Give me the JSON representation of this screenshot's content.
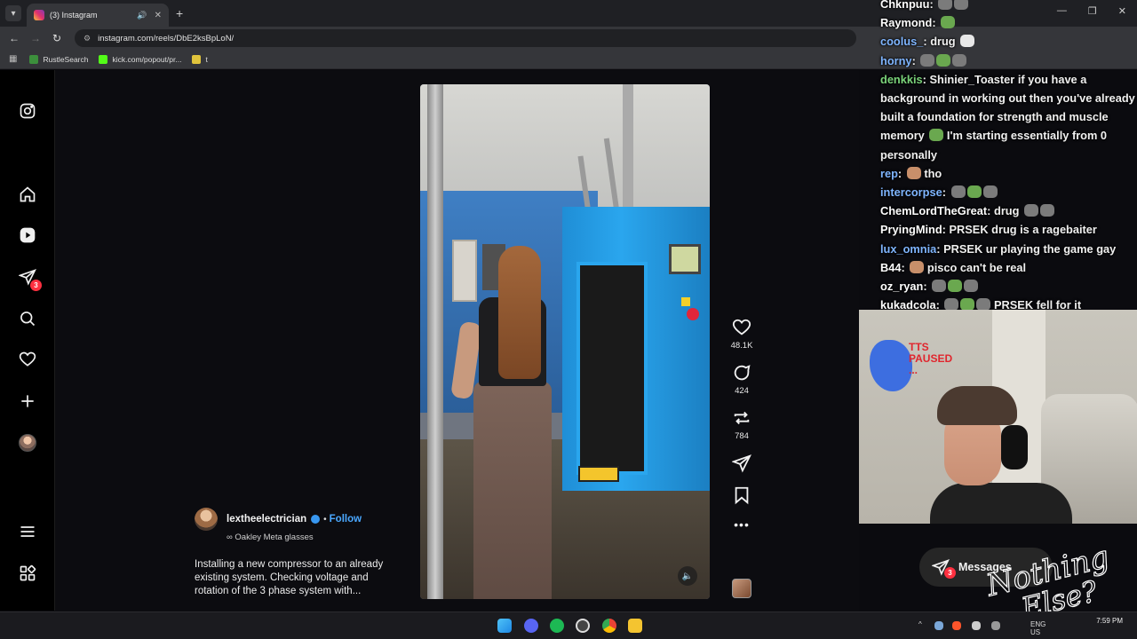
{
  "browser": {
    "tab_title": "(3) Instagram",
    "url": "instagram.com/reels/DbE2ksBpLoN/",
    "bookmarks": [
      {
        "label": "RustleSearch"
      },
      {
        "label": "kick.com/popout/pr..."
      },
      {
        "label": "t"
      }
    ]
  },
  "instagram": {
    "nav_notifications_count": "3",
    "reel": {
      "username": "lextheelectrician",
      "separator": "•",
      "follow_label": "Follow",
      "audio_icon": "∞",
      "audio_label": "Oakley Meta glasses",
      "caption": "Installing a new compressor to an already existing system. Checking voltage and rotation of the 3 phase system with..."
    },
    "actions": {
      "likes": "48.1K",
      "comments": "424",
      "reposts": "784",
      "more": "•••"
    },
    "messages": {
      "label": "Messages",
      "badge": "3"
    }
  },
  "chat": [
    {
      "user": "Chknpuu",
      "msg": "",
      "color": "#ffffff"
    },
    {
      "user": "Raymond",
      "msg": "",
      "color": "#ffffff"
    },
    {
      "user": "coolus_",
      "msg": "drug",
      "color": "#7fb5ff"
    },
    {
      "user": "horny",
      "msg": "",
      "color": "#7fb5ff"
    },
    {
      "user": "denkkis",
      "msg": "Shinier_Toaster if you have a background in working out then you've already built a foundation for strength and muscle memory",
      "tail": "I'm starting essentially from 0 personally",
      "color": "#7ad37a"
    },
    {
      "user": "rep",
      "msg": "tho",
      "color": "#7fb5ff"
    },
    {
      "user": "intercorpse",
      "msg": "",
      "color": "#7fb5ff"
    },
    {
      "user": "ChemLordTheGreat",
      "msg": "drug",
      "color": "#ffffff"
    },
    {
      "user": "PryingMind",
      "msg": "PRSEK drug is a ragebaiter",
      "color": "#ffffff"
    },
    {
      "user": "lux_omnia",
      "msg": "PRSEK ur playing the game gay",
      "color": "#7fb5ff"
    },
    {
      "user": "B44",
      "msg": "pisco can't be real",
      "color": "#ffffff"
    },
    {
      "user": "oz_ryan",
      "msg": "",
      "color": "#ffffff"
    },
    {
      "user": "kukadcola",
      "msg": "PRSEK fell for it",
      "color": "#ffffff"
    }
  ],
  "webcam": {
    "overlay_text_1": "TTS",
    "overlay_text_2": "PAUSED",
    "overlay_text_3": "..."
  },
  "overlay_logo": {
    "line1": "Nothing",
    "line2": "Else?"
  },
  "taskbar": {
    "lang": "ENG",
    "region": "US",
    "time": "7:59 PM"
  },
  "colors": {
    "instagram_bg": "#0c0c10",
    "follow_blue": "#4aa8ff",
    "notification_red": "#ff3040",
    "compressor_blue": "#2aa6ee"
  }
}
